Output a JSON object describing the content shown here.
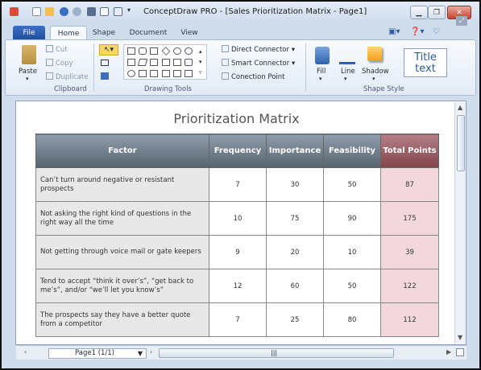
{
  "window": {
    "title": "ConceptDraw PRO - [Sales Prioritization Matrix - Page1]"
  },
  "ribbon_tabs": {
    "file": "File",
    "tabs": [
      "Home",
      "Shape",
      "Document",
      "View"
    ]
  },
  "clipboard": {
    "paste": "Paste",
    "cut": "Cut",
    "copy": "Copy",
    "duplicate": "Duplicate",
    "group_label": "Clipboard"
  },
  "drawing_tools": {
    "group_label": "Drawing Tools",
    "direct_connector": "Direct Connector",
    "smart_connector": "Smart Connector",
    "connection_point": "Conection Point"
  },
  "shape_style": {
    "group_label": "Shape Style",
    "fill": "Fill",
    "line": "Line",
    "shadow": "Shadow",
    "title_text_line1": "Title",
    "title_text_line2": "text"
  },
  "page": {
    "title": "Prioritization Matrix"
  },
  "table": {
    "headers": [
      "Factor",
      "Frequency",
      "Importance",
      "Feasibility",
      "Total Points"
    ],
    "rows": [
      {
        "factor": "Can’t turn around negative or resistant prospects",
        "frequency": "7",
        "importance": "30",
        "feasibility": "50",
        "total": "87"
      },
      {
        "factor": "Not asking the right kind of questions in the right way all the time",
        "frequency": "10",
        "importance": "75",
        "feasibility": "90",
        "total": "175"
      },
      {
        "factor": "Not getting through voice mail or gate keepers",
        "frequency": "9",
        "importance": "20",
        "feasibility": "10",
        "total": "39"
      },
      {
        "factor": "Tend to accept “think it over’s”, “get back to me’s”, and/or “we’ll let you know’s”",
        "frequency": "12",
        "importance": "60",
        "feasibility": "50",
        "total": "122"
      },
      {
        "factor": "The prospects say they have a better quote from a competitor",
        "frequency": "7",
        "importance": "25",
        "feasibility": "80",
        "total": "112"
      }
    ]
  },
  "statusbar": {
    "page_selector": "Page1 (1/1)"
  }
}
